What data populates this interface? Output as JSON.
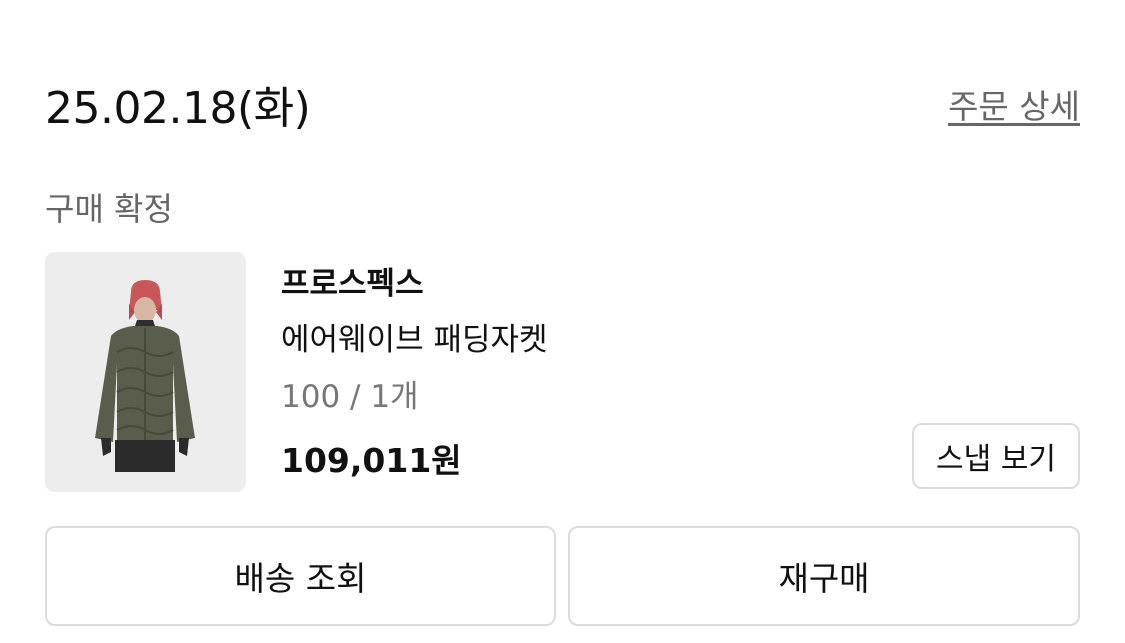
{
  "order": {
    "date": "25.02.18(화)",
    "detail_link": "주문 상세",
    "status": "구매 확정"
  },
  "product": {
    "brand": "프로스펙스",
    "name": "에어웨이브 패딩자켓",
    "option": "100 / 1개",
    "price": "109,011원",
    "image_icon": "product-photo-padded-jacket-model"
  },
  "buttons": {
    "snap": "스냅 보기",
    "track": "배송 조회",
    "rebuy": "재구매"
  },
  "colors": {
    "text_primary": "#111111",
    "text_secondary": "#666666",
    "border": "#dcdcdc",
    "thumb_bg": "#ededed"
  }
}
